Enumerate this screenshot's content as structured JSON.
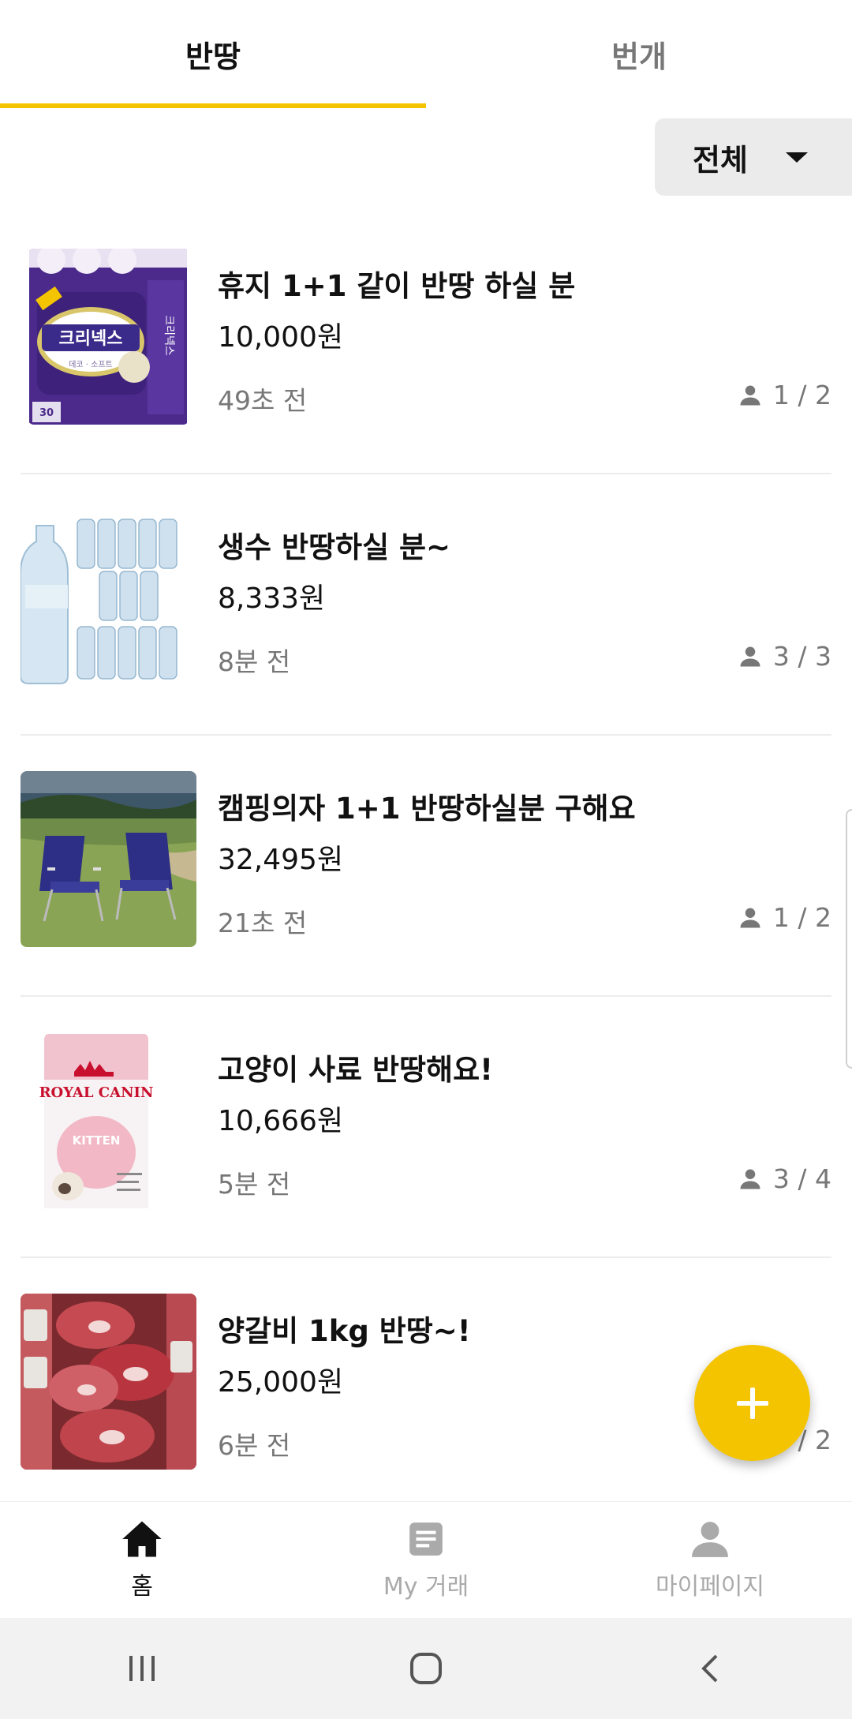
{
  "tabs": [
    {
      "label": "반땅",
      "active": true
    },
    {
      "label": "번개",
      "active": false
    }
  ],
  "filter": {
    "label": "전체"
  },
  "colors": {
    "accent": "#f5c400",
    "muted": "#777777",
    "nav_inactive": "#aaaaaa"
  },
  "items": [
    {
      "title": "휴지 1+1 같이 반땅 하실 분",
      "price": "10,000원",
      "time": "49초 전",
      "people": "1 / 2",
      "image": "toilet-paper"
    },
    {
      "title": "생수 반땅하실 분~",
      "price": "8,333원",
      "time": "8분 전",
      "people": "3 / 3",
      "image": "water-bottles"
    },
    {
      "title": "캠핑의자 1+1 반땅하실분 구해요",
      "price": "32,495원",
      "time": "21초 전",
      "people": "1 / 2",
      "image": "camping-chairs"
    },
    {
      "title": "고양이 사료 반땅해요!",
      "price": "10,666원",
      "time": "5분 전",
      "people": "3 / 4",
      "image": "cat-food"
    },
    {
      "title": "양갈비 1kg 반땅~!",
      "price": "25,000원",
      "time": "6분 전",
      "people": "1 / 2",
      "image": "lamb-ribs"
    }
  ],
  "image_text": {
    "toilet_paper_brand": "크리넥스",
    "cat_food_brand": "ROYAL CANIN",
    "cat_food_variant": "KITTEN"
  },
  "fab": {
    "icon": "plus-icon"
  },
  "bottom_nav": [
    {
      "label": "홈",
      "icon": "home-icon",
      "active": true
    },
    {
      "label": "My 거래",
      "icon": "document-icon",
      "active": false
    },
    {
      "label": "마이페이지",
      "icon": "person-icon",
      "active": false
    }
  ],
  "system_nav": [
    "recents-icon",
    "home-circle-icon",
    "back-icon"
  ]
}
